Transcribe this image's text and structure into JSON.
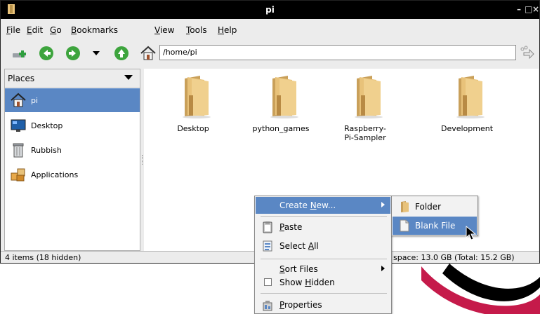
{
  "window": {
    "title": "pi",
    "minimize_glyph": "–",
    "maximize_glyph": "□",
    "close_glyph": "×"
  },
  "menubar": {
    "items": [
      {
        "accel": "F",
        "rest": "ile"
      },
      {
        "accel": "E",
        "rest": "dit"
      },
      {
        "accel": "G",
        "rest": "o"
      },
      {
        "accel": "B",
        "rest": "ookmarks"
      },
      {
        "accel": "V",
        "rest": "iew"
      },
      {
        "accel": "T",
        "rest": "ools"
      },
      {
        "accel": "H",
        "rest": "elp"
      }
    ]
  },
  "toolbar": {
    "address_value": "/home/pi",
    "icons": [
      "new-tab-icon",
      "back-icon",
      "forward-icon",
      "history-dropdown-icon",
      "up-icon",
      "home-icon",
      "go-icon"
    ]
  },
  "sidebar": {
    "header": "Places",
    "items": [
      {
        "label": "pi",
        "icon": "home-icon"
      },
      {
        "label": "Desktop",
        "icon": "desktop-icon"
      },
      {
        "label": "Rubbish",
        "icon": "trash-icon"
      },
      {
        "label": "Applications",
        "icon": "applications-icon"
      }
    ]
  },
  "files": [
    {
      "name": "Desktop"
    },
    {
      "name": "python_games"
    },
    {
      "name": "Raspberry-Pi-Sampler"
    },
    {
      "name": "Development"
    }
  ],
  "status": {
    "left": "4 items (18 hidden)",
    "right": "space: 13.0 GB (Total: 15.2 GB)"
  },
  "context_menu": {
    "create_new_pre": "Create ",
    "create_new_accel": "N",
    "create_new_post": "ew...",
    "paste_accel": "P",
    "paste_rest": "aste",
    "select_all_pre": "Select ",
    "select_all_accel": "A",
    "select_all_post": "ll",
    "sort_files_accel": "S",
    "sort_files_rest": "ort Files",
    "show_hidden_pre": "Show ",
    "show_hidden_accel": "H",
    "show_hidden_post": "idden",
    "properties_accel": "P",
    "properties_rest": "roperties"
  },
  "submenu": {
    "folder": "Folder",
    "blank_file": "Blank File"
  },
  "colors": {
    "selection": "#5a87c4",
    "folder": "#e8c27a",
    "swoosh_red": "#c51a4a"
  }
}
